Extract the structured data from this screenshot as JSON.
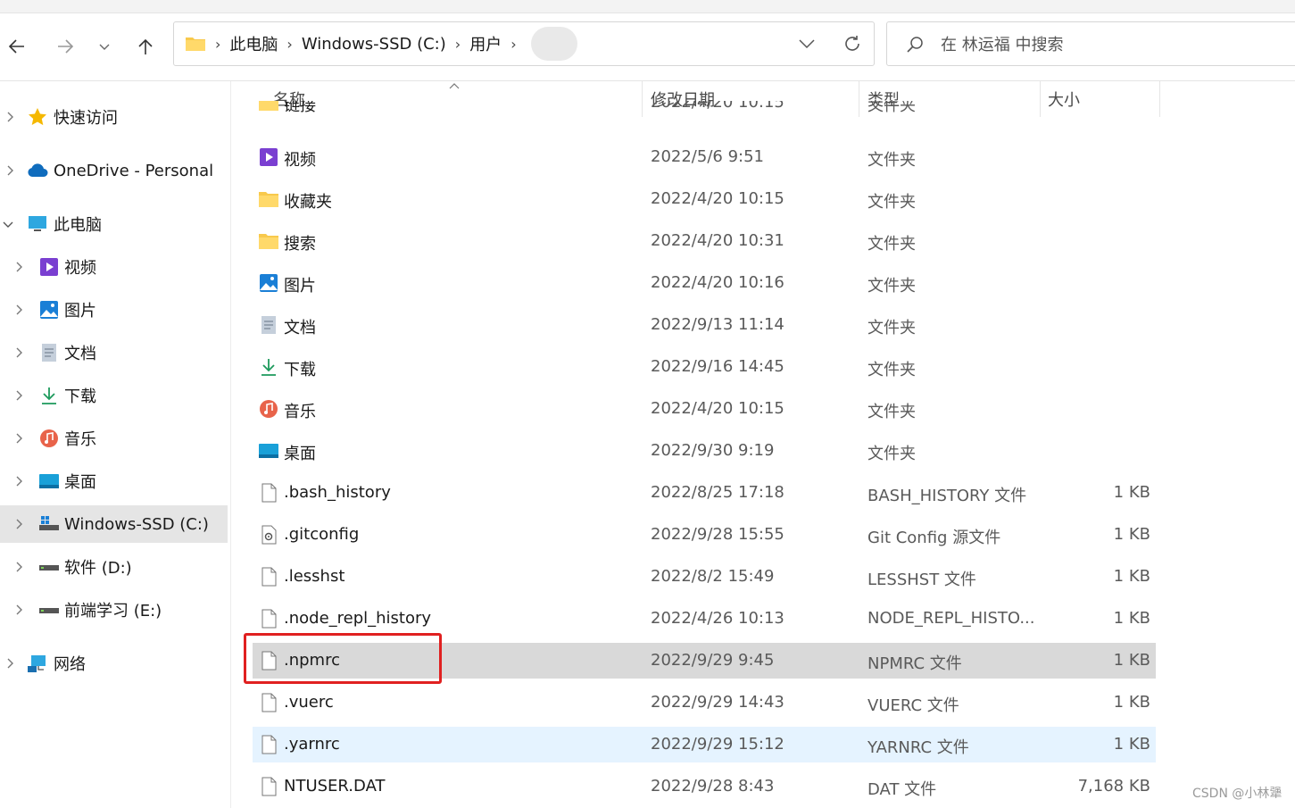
{
  "breadcrumb": [
    "此电脑",
    "Windows-SSD (C:)",
    "用户"
  ],
  "search": {
    "placeholder": "在 林运福 中搜索"
  },
  "columns": {
    "name": "名称",
    "date": "修改日期",
    "type": "类型",
    "size": "大小"
  },
  "partial_row": {
    "name": "链接",
    "date": "2022/4/20 10:15",
    "type": "文件夹"
  },
  "sidebar": {
    "items": [
      {
        "label": "快速访问",
        "icon": "star-icon"
      },
      {
        "label": "OneDrive - Personal",
        "icon": "cloud-icon"
      },
      {
        "label": "此电脑",
        "icon": "pc-icon"
      },
      {
        "label": "视频",
        "icon": "video-folder-icon"
      },
      {
        "label": "图片",
        "icon": "pictures-folder-icon"
      },
      {
        "label": "文档",
        "icon": "documents-folder-icon"
      },
      {
        "label": "下载",
        "icon": "download-icon"
      },
      {
        "label": "音乐",
        "icon": "music-icon"
      },
      {
        "label": "桌面",
        "icon": "desktop-folder-icon"
      },
      {
        "label": "Windows-SSD (C:)",
        "icon": "system-drive-icon"
      },
      {
        "label": "软件 (D:)",
        "icon": "drive-icon"
      },
      {
        "label": "前端学习 (E:)",
        "icon": "drive-icon"
      },
      {
        "label": "网络",
        "icon": "network-icon"
      }
    ]
  },
  "files": [
    {
      "name": "视频",
      "date": "2022/5/6 9:51",
      "type": "文件夹",
      "size": "",
      "icon": "video-folder-icon"
    },
    {
      "name": "收藏夹",
      "date": "2022/4/20 10:15",
      "type": "文件夹",
      "size": "",
      "icon": "folder-icon"
    },
    {
      "name": "搜索",
      "date": "2022/4/20 10:31",
      "type": "文件夹",
      "size": "",
      "icon": "folder-icon"
    },
    {
      "name": "图片",
      "date": "2022/4/20 10:16",
      "type": "文件夹",
      "size": "",
      "icon": "pictures-folder-icon"
    },
    {
      "name": "文档",
      "date": "2022/9/13 11:14",
      "type": "文件夹",
      "size": "",
      "icon": "documents-folder-icon"
    },
    {
      "name": "下载",
      "date": "2022/9/16 14:45",
      "type": "文件夹",
      "size": "",
      "icon": "download-icon"
    },
    {
      "name": "音乐",
      "date": "2022/4/20 10:15",
      "type": "文件夹",
      "size": "",
      "icon": "music-icon"
    },
    {
      "name": "桌面",
      "date": "2022/9/30 9:19",
      "type": "文件夹",
      "size": "",
      "icon": "desktop-folder-icon"
    },
    {
      "name": ".bash_history",
      "date": "2022/8/25 17:18",
      "type": "BASH_HISTORY 文件",
      "size": "1 KB",
      "icon": "file-icon"
    },
    {
      "name": ".gitconfig",
      "date": "2022/9/28 15:55",
      "type": "Git Config 源文件",
      "size": "1 KB",
      "icon": "config-file-icon"
    },
    {
      "name": ".lesshst",
      "date": "2022/8/2 15:49",
      "type": "LESSHST 文件",
      "size": "1 KB",
      "icon": "file-icon"
    },
    {
      "name": ".node_repl_history",
      "date": "2022/4/26 10:13",
      "type": "NODE_REPL_HISTO...",
      "size": "1 KB",
      "icon": "file-icon"
    },
    {
      "name": ".npmrc",
      "date": "2022/9/29 9:45",
      "type": "NPMRC 文件",
      "size": "1 KB",
      "icon": "file-icon"
    },
    {
      "name": ".vuerc",
      "date": "2022/9/29 14:43",
      "type": "VUERC 文件",
      "size": "1 KB",
      "icon": "file-icon"
    },
    {
      "name": ".yarnrc",
      "date": "2022/9/29 15:12",
      "type": "YARNRC 文件",
      "size": "1 KB",
      "icon": "file-icon"
    },
    {
      "name": "NTUSER.DAT",
      "date": "2022/9/28 8:43",
      "type": "DAT 文件",
      "size": "7,168 KB",
      "icon": "file-icon"
    }
  ],
  "watermark": "CSDN @小林犟"
}
